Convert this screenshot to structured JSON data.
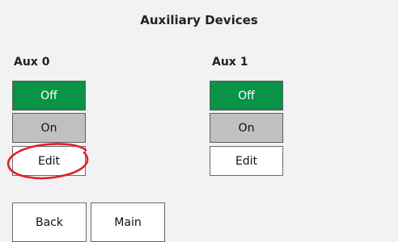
{
  "header": {
    "title": "Auxiliary Devices"
  },
  "devices": [
    {
      "label": "Aux 0",
      "off_label": "Off",
      "on_label": "On",
      "edit_label": "Edit"
    },
    {
      "label": "Aux 1",
      "off_label": "Off",
      "on_label": "On",
      "edit_label": "Edit"
    }
  ],
  "nav": {
    "back_label": "Back",
    "main_label": "Main"
  },
  "colors": {
    "off_active": "#0a9247",
    "on_inactive": "#c0c0c0",
    "annotation": "#e0202a",
    "background": "#f2f2f2"
  }
}
